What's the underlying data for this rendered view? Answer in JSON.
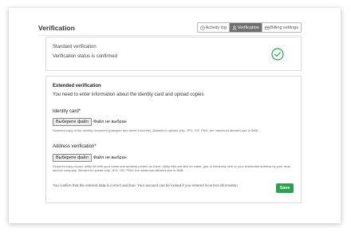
{
  "page": {
    "title": "Verification"
  },
  "tabs": [
    {
      "label": "Activity log",
      "icon": "clock-icon",
      "active": false
    },
    {
      "label": "Verification",
      "icon": "user-icon",
      "active": true
    },
    {
      "label": "Billing settings",
      "icon": "card-icon",
      "active": false
    }
  ],
  "standard": {
    "title": "Standard verification",
    "status": "Verification status is confirmed",
    "status_icon": "check-circle-icon",
    "status_color": "#2e9f4f"
  },
  "extended": {
    "title": "Extended verification",
    "description": "You need to enter information about the identity card and upload copies",
    "identity": {
      "label": "Identity card*",
      "button": "Выберите файл",
      "state": "Файл не выбран",
      "help": "Scanned copy of the identity document (passport and driver's license). Allowed to upload only: JPG, GIF, PNG, the maximum allowed size is 5MB"
    },
    "address": {
      "label": "Address verification*",
      "button": "Выберите файл",
      "state": "Файл не выбран",
      "help": "Scanned copy of your utility bill with your name and address printed on them. Utility bills are bills for water, gas or electricity sent to your residential address by your local service company. Allowed to upload only: JPG, GIF, PNG, the maximum allowed size is 5MB"
    },
    "confirm": "You confirm that the entered data is correct and true. Your account can be locked if you entered incorrect information",
    "save": "Save",
    "save_color": "#2e9f4f"
  }
}
